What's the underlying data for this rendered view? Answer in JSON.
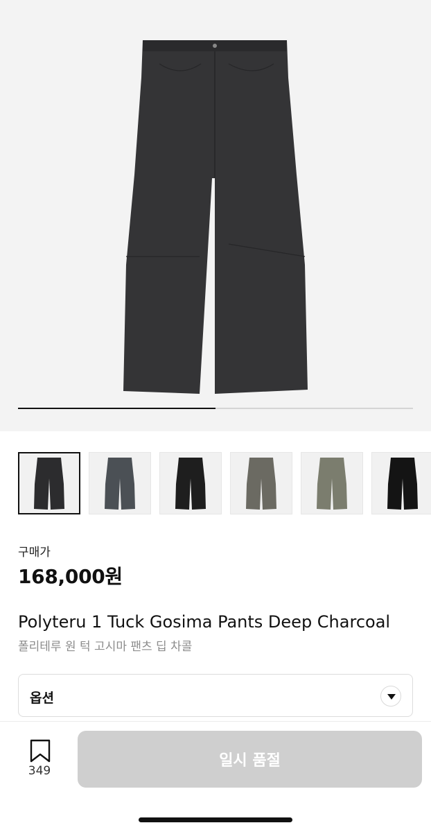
{
  "gallery": {
    "current_index": 1,
    "total_images": 2,
    "progress_fraction": 0.5
  },
  "thumbnails": [
    {
      "color_name": "Deep Charcoal",
      "fill": "#2c2c2e",
      "selected": true
    },
    {
      "color_name": "Grey",
      "fill": "#4b5055",
      "selected": false
    },
    {
      "color_name": "Black Panel",
      "fill": "#1e1e1e",
      "selected": false
    },
    {
      "color_name": "Khaki Grey",
      "fill": "#6b6a62",
      "selected": false
    },
    {
      "color_name": "Olive",
      "fill": "#7b7d6e",
      "selected": false
    },
    {
      "color_name": "Black",
      "fill": "#141414",
      "selected": false
    }
  ],
  "price": {
    "label": "구매가",
    "value": "168,000원"
  },
  "product": {
    "title_en": "Polyteru 1 Tuck Gosima Pants Deep Charcoal",
    "title_ko": "폴리테루 원 턱 고시마 팬츠 딥 차콜"
  },
  "option": {
    "label": "옵션",
    "icon": "chevron-down-icon"
  },
  "bottom_bar": {
    "bookmark_icon": "bookmark-icon",
    "bookmark_count": "349",
    "cta_label": "일시 품절",
    "cta_color": "#cfcfcf"
  },
  "colors": {
    "hero_bg": "#f3f3f3",
    "pants": "#343436"
  }
}
